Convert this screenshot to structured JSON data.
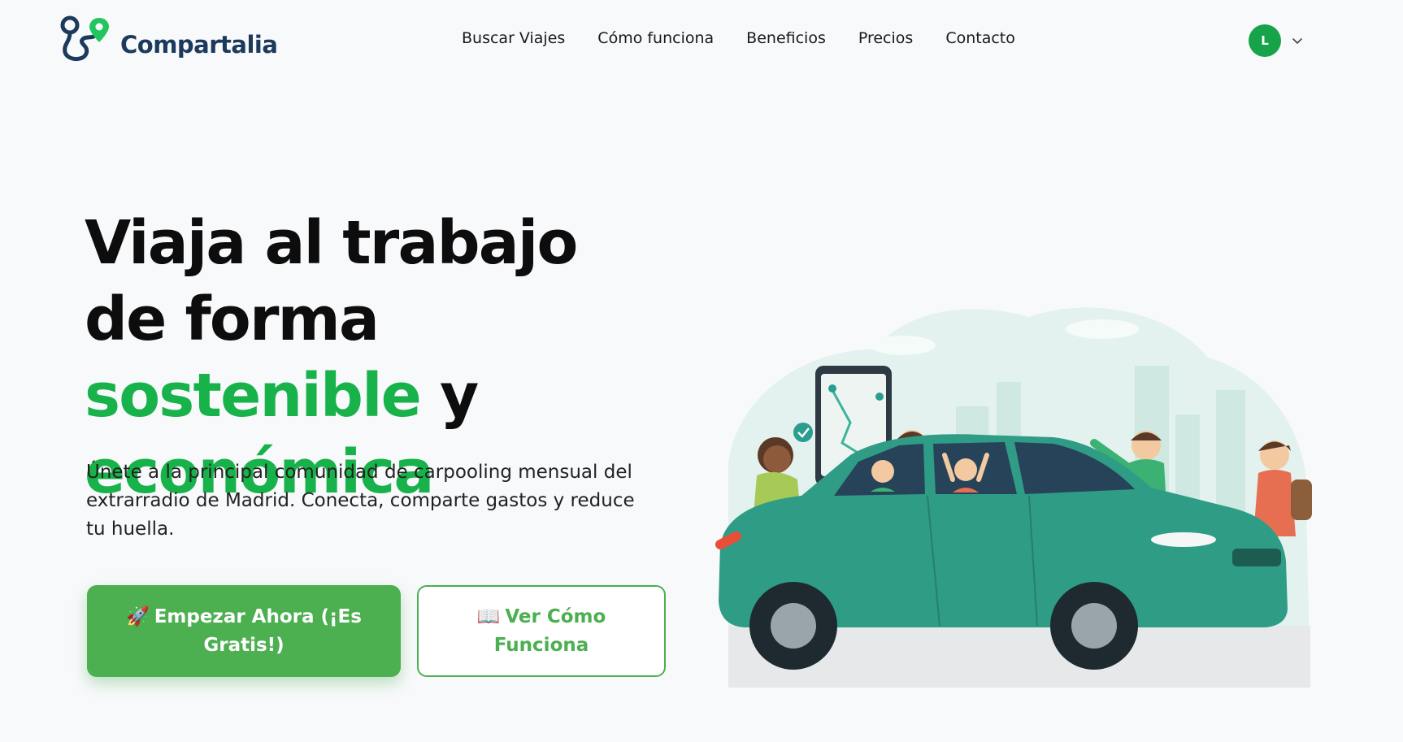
{
  "brand": {
    "name": "Compartalia",
    "colors": {
      "navy": "#1b3a5c",
      "green": "#18b24a",
      "button_green": "#4caf50"
    }
  },
  "nav": {
    "items": [
      "Buscar Viajes",
      "Cómo funciona",
      "Beneficios",
      "Precios",
      "Contacto"
    ]
  },
  "user": {
    "avatar_initial": "L",
    "menu_icon": "chevron-down-icon"
  },
  "hero": {
    "title_part1": "Viaja al trabajo de forma ",
    "title_highlight1": "sostenible",
    "title_part2": " y ",
    "title_highlight2": "económica",
    "subtitle": "Únete a la principal comunidad de carpooling mensual del extrarradio de Madrid. Conecta, comparte gastos y reduce tu huella.",
    "primary_cta": {
      "icon": "🚀",
      "label": "Empezar Ahora (¡Es Gratis!)"
    },
    "secondary_cta": {
      "icon": "📖",
      "label": "Ver Cómo Funciona"
    }
  }
}
